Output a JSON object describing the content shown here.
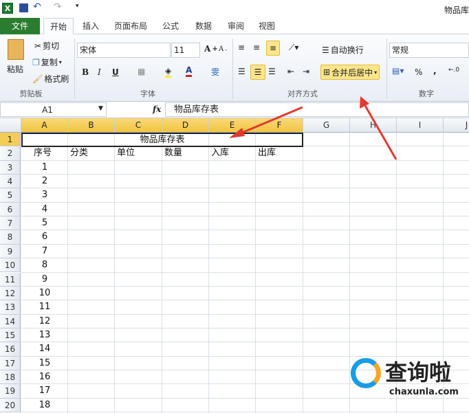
{
  "window": {
    "title": "物品库"
  },
  "tabs": [
    {
      "label": "文件"
    },
    {
      "label": "开始"
    },
    {
      "label": "插入"
    },
    {
      "label": "页面布局"
    },
    {
      "label": "公式"
    },
    {
      "label": "数据"
    },
    {
      "label": "审阅"
    },
    {
      "label": "视图"
    }
  ],
  "ribbon": {
    "clipboard": {
      "paste": "粘贴",
      "cut": "剪切",
      "copy": "复制",
      "format_painter": "格式刷",
      "label": "剪贴板"
    },
    "font": {
      "name": "宋体",
      "size": "11",
      "bold": "B",
      "italic": "I",
      "underline": "U",
      "label": "字体"
    },
    "alignment": {
      "wrap": "自动换行",
      "merge": "合并后居中",
      "label": "对齐方式"
    },
    "number": {
      "format": "常规",
      "percent": "%",
      "comma": ",",
      "label": "数字"
    }
  },
  "formula_bar": {
    "name_box": "A1",
    "fx": "fx",
    "value": "物品库存表"
  },
  "columns": [
    "A",
    "B",
    "C",
    "D",
    "E",
    "F",
    "G",
    "H",
    "I",
    "J"
  ],
  "rows": [
    "1",
    "2",
    "3",
    "4",
    "5",
    "6",
    "7",
    "8",
    "9",
    "10",
    "11",
    "12",
    "13",
    "14",
    "15",
    "16",
    "17",
    "18",
    "19",
    "20"
  ],
  "sheet": {
    "title": "物品库存表",
    "headers": [
      "序号",
      "分类",
      "单位",
      "数量",
      "入库",
      "出库"
    ],
    "serials": [
      "1",
      "2",
      "3",
      "4",
      "5",
      "6",
      "7",
      "8",
      "9",
      "10",
      "11",
      "12",
      "13",
      "14",
      "15",
      "16",
      "17",
      "18"
    ]
  },
  "watermark": {
    "text": "查询啦",
    "url": "chaxunla.com"
  },
  "colors": {
    "file_tab": "#2a7d2e",
    "highlight": "#fde58a",
    "arrow": "#e03a2f"
  }
}
